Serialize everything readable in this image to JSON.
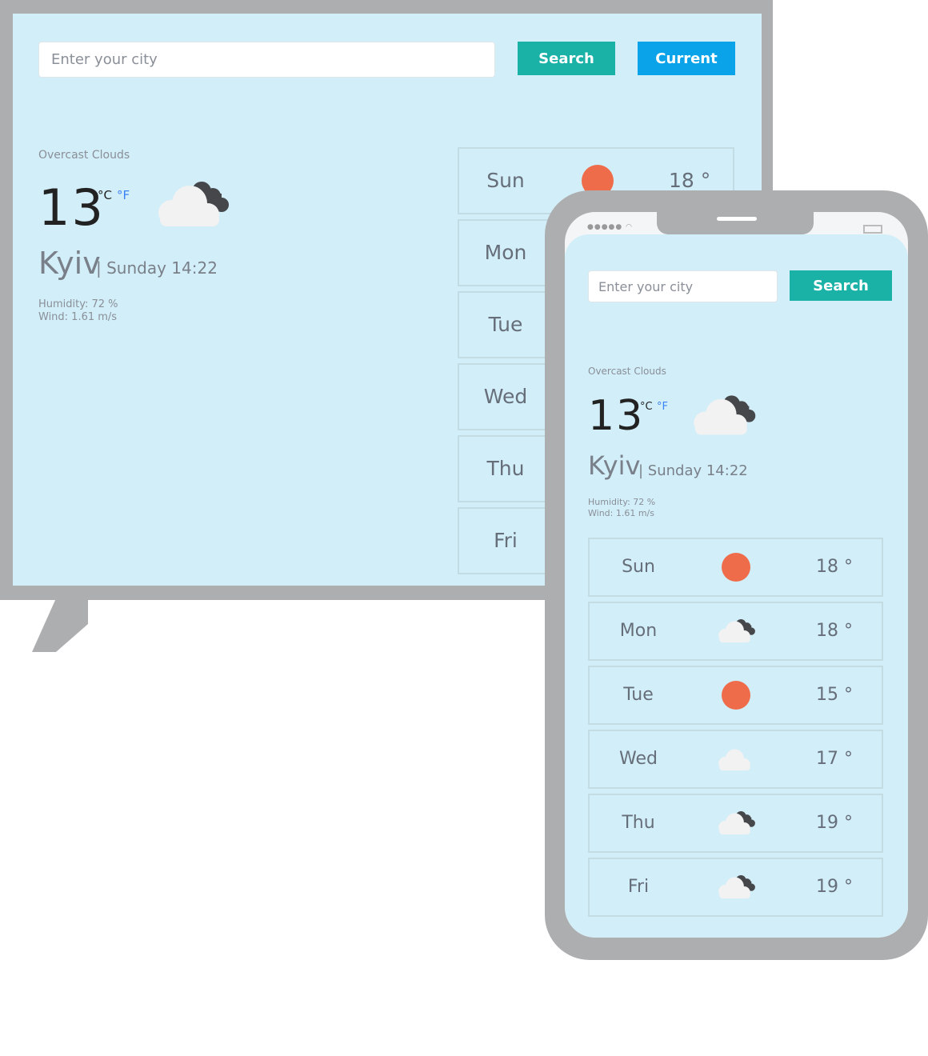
{
  "colors": {
    "background": "#d2eef8",
    "frame": "#adaeb0",
    "search": "#1ab1a6",
    "current": "#0aa3ea",
    "sun": "#ee6c4a"
  },
  "desktop": {
    "search": {
      "placeholder": "Enter your city",
      "button": "Search"
    },
    "current_button": "Current",
    "weather": {
      "description": "Overcast Clouds",
      "temp": "13",
      "unit_c": "°C",
      "unit_f": "°F",
      "icon": "broken-clouds-icon",
      "city": "Kyiv",
      "datetime": "| Sunday 14:22",
      "humidity": "Humidity: 72 %",
      "wind": "Wind: 1.61 m/s"
    },
    "forecast": [
      {
        "day": "Sun",
        "icon": "sun-icon",
        "temp": "18 °"
      },
      {
        "day": "Mon",
        "icon": "broken-clouds-icon",
        "temp": ""
      },
      {
        "day": "Tue",
        "icon": "sun-icon",
        "temp": ""
      },
      {
        "day": "Wed",
        "icon": "cloud-icon",
        "temp": ""
      },
      {
        "day": "Thu",
        "icon": "broken-clouds-icon",
        "temp": ""
      },
      {
        "day": "Fri",
        "icon": "broken-clouds-icon",
        "temp": ""
      }
    ]
  },
  "mobile": {
    "search": {
      "placeholder": "Enter your city",
      "button": "Search"
    },
    "weather": {
      "description": "Overcast Clouds",
      "temp": "13",
      "unit_c": "°C",
      "unit_f": "°F",
      "icon": "broken-clouds-icon",
      "city": "Kyiv",
      "datetime": "| Sunday 14:22",
      "humidity": "Humidity: 72 %",
      "wind": "Wind: 1.61 m/s"
    },
    "forecast": [
      {
        "day": "Sun",
        "icon": "sun-icon",
        "temp": "18 °"
      },
      {
        "day": "Mon",
        "icon": "broken-clouds-icon",
        "temp": "18 °"
      },
      {
        "day": "Tue",
        "icon": "sun-icon",
        "temp": "15 °"
      },
      {
        "day": "Wed",
        "icon": "cloud-icon",
        "temp": "17 °"
      },
      {
        "day": "Thu",
        "icon": "broken-clouds-icon",
        "temp": "19 °"
      },
      {
        "day": "Fri",
        "icon": "broken-clouds-icon",
        "temp": "19 °"
      }
    ]
  }
}
